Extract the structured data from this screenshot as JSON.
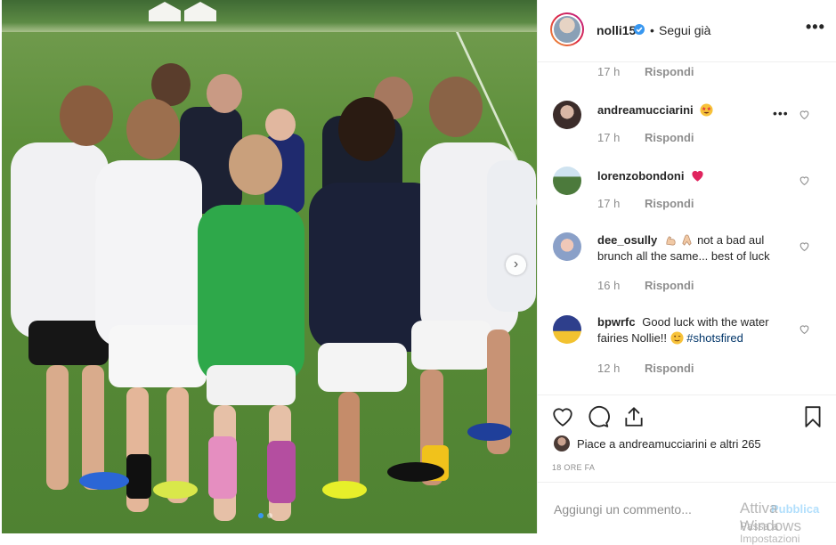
{
  "post": {
    "username": "nolli15",
    "separator": "•",
    "follow_status": "Segui già",
    "more_label": "•••"
  },
  "comments": {
    "top_meta": {
      "time": "17 h",
      "reply": "Rispondi"
    },
    "items": [
      {
        "user": "andreamucciarini",
        "text": "",
        "emoji": "star-struck-icon",
        "time": "17 h",
        "reply": "Rispondi",
        "avatar_color": "#3b2c2a"
      },
      {
        "user": "lorenzobondoni",
        "text": "",
        "emoji": "red-heart-icon",
        "time": "17 h",
        "reply": "Rispondi",
        "avatar_color": "#4c7a3c"
      },
      {
        "user": "dee_osully",
        "text_before": "",
        "text": "not a bad aul brunch all the same... best of luck",
        "emoji": "flexed-biceps-icon",
        "time": "16 h",
        "reply": "Rispondi",
        "avatar_color": "#8aa0c8"
      },
      {
        "user": "bpwrfc",
        "text": "Good luck with the water fairies Nollie!!",
        "hashtag": "#shotsfired",
        "time": "12 h",
        "reply": "Rispondi",
        "avatar_color": "#2e3f8c"
      }
    ]
  },
  "likes": {
    "text": "Piace a andreamucciarini e altri 265"
  },
  "timestamp": "18 ORE FA",
  "composer": {
    "placeholder": "Aggiungi un commento...",
    "publish": "Pubblica"
  },
  "watermark": {
    "line1": "Attiva Windows",
    "line2": "Passa a Impostazioni"
  },
  "colors": {
    "link": "#003569",
    "verified": "#3897f0",
    "heart_red": "#ed4956",
    "muted": "#8e8e8e"
  }
}
